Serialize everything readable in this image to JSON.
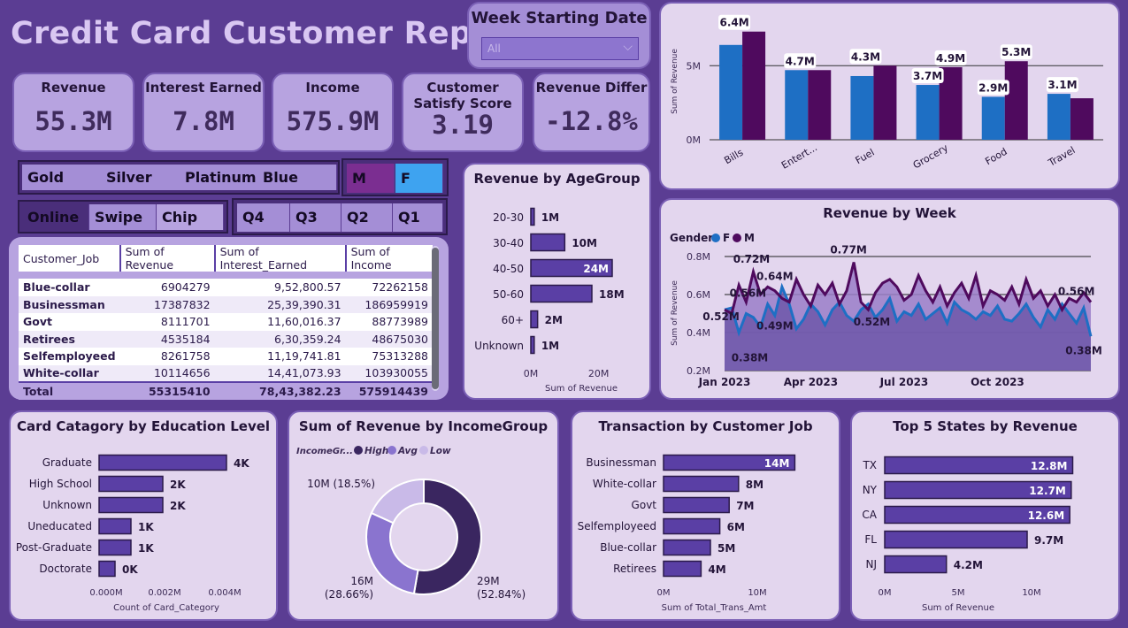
{
  "report_title": "Credit Card Customer Report",
  "week_filter": {
    "label": "Week Starting Date",
    "value": "All"
  },
  "kpis": [
    {
      "label": "Revenue",
      "value": "55.3M"
    },
    {
      "label": "Interest Earned",
      "value": "7.8M"
    },
    {
      "label": "Income",
      "value": "575.9M"
    },
    {
      "label": "Customer Satisfy Score",
      "value": "3.19"
    },
    {
      "label": "Revenue Differ",
      "value": "-12.8%"
    }
  ],
  "card_slicer": [
    "Gold",
    "Silver",
    "Platinum",
    "Blue"
  ],
  "gender_slicer": [
    "M",
    "F"
  ],
  "channel_slicer": [
    "Online",
    "Swipe",
    "Chip"
  ],
  "quarter_slicer": [
    "Q4",
    "Q3",
    "Q2",
    "Q1"
  ],
  "table": {
    "headers": [
      "Customer_Job",
      "Sum of Revenue",
      "Sum of Interest_Earned",
      "Sum of Income"
    ],
    "rows": [
      [
        "Blue-collar",
        "6904279",
        "9,52,800.57",
        "72262158"
      ],
      [
        "Businessman",
        "17387832",
        "25,39,390.31",
        "186959919"
      ],
      [
        "Govt",
        "8111701",
        "11,60,016.37",
        "88773989"
      ],
      [
        "Retirees",
        "4535184",
        "6,30,359.24",
        "48675030"
      ],
      [
        "Selfemployeed",
        "8261758",
        "11,19,741.81",
        "75313288"
      ],
      [
        "White-collar",
        "10114656",
        "14,41,073.93",
        "103930055"
      ]
    ],
    "total": [
      "Total",
      "55315410",
      "78,43,382.23",
      "575914439"
    ]
  },
  "colors": {
    "female": "#1e6fc4",
    "male": "#4f0a5e",
    "bar": "#5a3fa5",
    "bg": "#5b3d93"
  },
  "chart_data": [
    {
      "type": "bar",
      "title": "",
      "ylabel": "Sum of Revenue",
      "categories": [
        "Bills",
        "Entert...",
        "Fuel",
        "Grocery",
        "Food",
        "Travel"
      ],
      "labels": [
        "6.4M",
        "4.7M",
        "4.3M",
        "3.7M",
        "4.9M",
        "2.9M",
        "5.3M",
        "3.1M"
      ],
      "series": [
        {
          "name": "F",
          "values": [
            6.4,
            4.7,
            4.3,
            3.7,
            2.9,
            3.1
          ]
        },
        {
          "name": "M",
          "values": [
            7.3,
            4.7,
            5.0,
            4.9,
            5.3,
            2.8
          ]
        }
      ],
      "yticks": [
        "0M",
        "5M"
      ],
      "ylim": [
        0,
        8
      ]
    },
    {
      "type": "bar",
      "title": "Revenue by AgeGroup",
      "categories": [
        "20-30",
        "30-40",
        "40-50",
        "50-60",
        "60+",
        "Unknown"
      ],
      "values": [
        1,
        10,
        24,
        18,
        2,
        1
      ],
      "labels": [
        "1M",
        "10M",
        "24M",
        "18M",
        "2M",
        "1M"
      ],
      "xticks": [
        "0M",
        "20M"
      ],
      "xlabel": "Sum of Revenue",
      "xlim": [
        0,
        30
      ]
    },
    {
      "type": "line",
      "title": "Revenue by Week",
      "legend_title": "Gender",
      "ylabel": "Sum of Revenue",
      "xticks": [
        "Jan 2023",
        "Apr 2023",
        "Jul 2023",
        "Oct 2023"
      ],
      "yticks": [
        "0.2M",
        "0.4M",
        "0.6M",
        "0.8M"
      ],
      "ylim": [
        0.2,
        0.8
      ],
      "series": [
        {
          "name": "F",
          "values": [
            0.52,
            0.53,
            0.4,
            0.5,
            0.48,
            0.43,
            0.55,
            0.49,
            0.64,
            0.55,
            0.42,
            0.47,
            0.55,
            0.51,
            0.44,
            0.52,
            0.56,
            0.49,
            0.46,
            0.52,
            0.55,
            0.48,
            0.52,
            0.58,
            0.46,
            0.51,
            0.49,
            0.55,
            0.47,
            0.5,
            0.53,
            0.45,
            0.56,
            0.52,
            0.5,
            0.47,
            0.51,
            0.49,
            0.54,
            0.47,
            0.46,
            0.5,
            0.55,
            0.48,
            0.43,
            0.52,
            0.47,
            0.55,
            0.5,
            0.45,
            0.53,
            0.38
          ]
        },
        {
          "name": "M",
          "values": [
            0.52,
            0.5,
            0.65,
            0.56,
            0.72,
            0.6,
            0.64,
            0.62,
            0.58,
            0.56,
            0.68,
            0.6,
            0.54,
            0.65,
            0.6,
            0.66,
            0.55,
            0.62,
            0.77,
            0.56,
            0.52,
            0.61,
            0.66,
            0.68,
            0.64,
            0.57,
            0.6,
            0.7,
            0.62,
            0.56,
            0.64,
            0.54,
            0.61,
            0.66,
            0.58,
            0.7,
            0.54,
            0.62,
            0.6,
            0.57,
            0.64,
            0.55,
            0.68,
            0.58,
            0.62,
            0.54,
            0.6,
            0.52,
            0.58,
            0.56,
            0.61,
            0.56
          ]
        }
      ],
      "labels": [
        "0.52M",
        "0.72M",
        "0.64M",
        "0.56M",
        "0.49M",
        "0.38M",
        "0.77M",
        "0.52M",
        "0.56M",
        "0.38M"
      ]
    },
    {
      "type": "bar",
      "title": "Card Catagory by Education Level",
      "categories": [
        "Graduate",
        "High School",
        "Unknown",
        "Uneducated",
        "Post-Graduate",
        "Doctorate"
      ],
      "values": [
        4,
        2,
        2,
        1,
        1,
        0.5
      ],
      "labels": [
        "4K",
        "2K",
        "2K",
        "1K",
        "1K",
        "0K"
      ],
      "xticks": [
        "0.000M",
        "0.002M",
        "0.004M"
      ],
      "xlabel": "Count of Card_Category"
    },
    {
      "type": "pie",
      "title": "Sum of Revenue by IncomeGroup",
      "legend_title": "IncomeGr...",
      "legend": [
        "High",
        "Avg",
        "Low"
      ],
      "values": [
        29,
        16,
        10
      ],
      "labels": [
        "29M (52.84%)",
        "16M (28.66%)",
        "10M (18.5%)"
      ],
      "colors": [
        "#3a2660",
        "#8a74cf",
        "#c9bae8"
      ]
    },
    {
      "type": "bar",
      "title": "Transaction by Customer Job",
      "categories": [
        "Businessman",
        "White-collar",
        "Govt",
        "Selfemployeed",
        "Blue-collar",
        "Retirees"
      ],
      "values": [
        14,
        8,
        7,
        6,
        5,
        4
      ],
      "labels": [
        "14M",
        "8M",
        "7M",
        "6M",
        "5M",
        "4M"
      ],
      "xticks": [
        "0M",
        "10M"
      ],
      "xlabel": "Sum of Total_Trans_Amt",
      "xlim": [
        0,
        20
      ]
    },
    {
      "type": "bar",
      "title": "Top 5 States by Revenue",
      "categories": [
        "TX",
        "NY",
        "CA",
        "FL",
        "NJ"
      ],
      "values": [
        12.8,
        12.7,
        12.6,
        9.7,
        4.2
      ],
      "labels": [
        "12.8M",
        "12.7M",
        "12.6M",
        "9.7M",
        "4.2M"
      ],
      "xticks": [
        "0M",
        "5M",
        "10M"
      ],
      "xlabel": "Sum of Revenue",
      "xlim": [
        0,
        16
      ]
    }
  ]
}
